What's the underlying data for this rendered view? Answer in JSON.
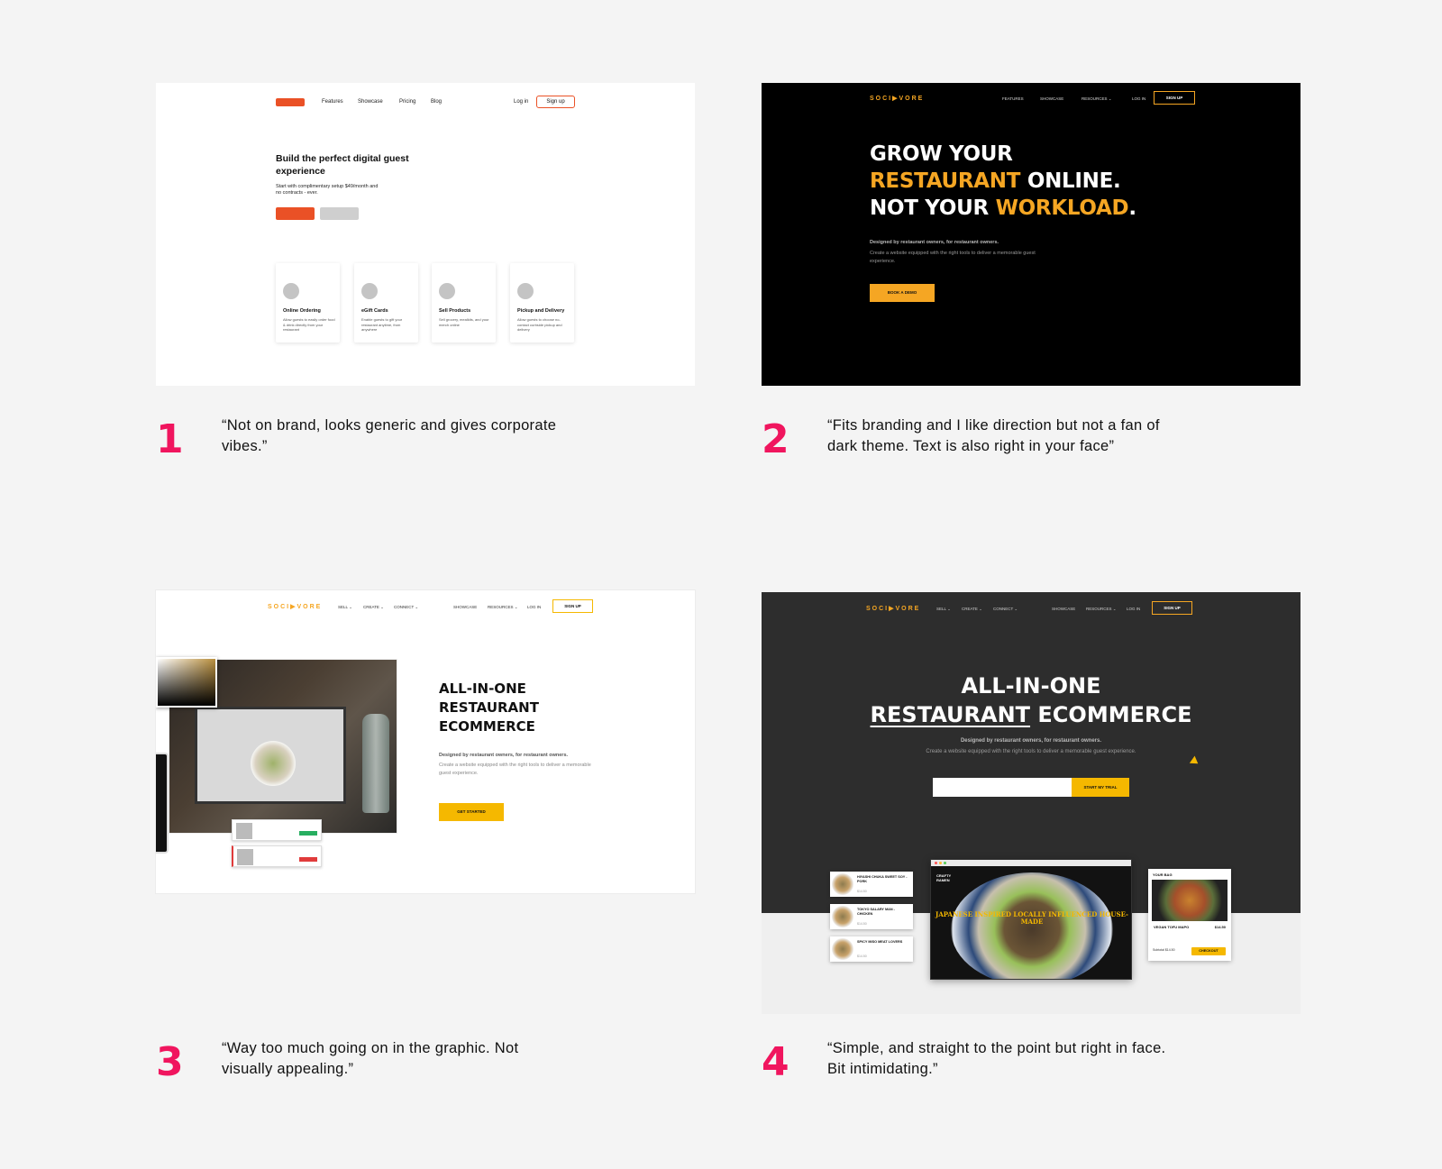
{
  "panel1": {
    "nav": [
      "Features",
      "Showcase",
      "Pricing",
      "Blog"
    ],
    "login": "Log in",
    "signup": "Sign up",
    "headline": "Build the perfect digital guest experience",
    "sub": "Start with complimentary setup $49/month and no contracts - ever.",
    "cards": [
      {
        "title": "Online Ordering",
        "desc": "Allow guests to easily order food & drink directly from your restaurant"
      },
      {
        "title": "eGift Cards",
        "desc": "Enable guests to gift your restaurant anytime, from anywhere"
      },
      {
        "title": "Sell Products",
        "desc": "Sell grocery, mealkits, and your merch online"
      },
      {
        "title": "Pickup and Delivery",
        "desc": "Allow guests to choose no-contact curbside pickup and delivery"
      }
    ],
    "accent": "#ea5126"
  },
  "panel2": {
    "logo": "SOCI▶VORE",
    "nav": [
      "FEATURES",
      "SHOWCASE",
      "RESOURCES ⌄",
      "LOG IN"
    ],
    "signup": "SIGN UP",
    "h_line1": "GROW YOUR",
    "h_line2_y": "RESTAURANT",
    "h_line2_w": " ONLINE.",
    "h_line3_w": "NOT YOUR ",
    "h_line3_y": "WORKLOAD",
    "h_line3_end": ".",
    "sub1": "Designed by restaurant owners, for restaurant owners.",
    "sub2": "Create a website equipped with the right tools to deliver a memorable guest experience.",
    "cta": "BOOK A DEMO",
    "accent": "#f5a623"
  },
  "panel3": {
    "logo": "SOCI▶VORE",
    "nav_left": [
      "SELL ⌄",
      "CREATE ⌄",
      "CONNECT ⌄"
    ],
    "nav_right": [
      "SHOWCASE",
      "RESOURCES ⌄",
      "LOG IN"
    ],
    "signup": "SIGN UP",
    "headline": "ALL-IN-ONE RESTAURANT ECOMMERCE",
    "sub1": "Designed by restaurant owners, for restaurant owners.",
    "sub2": "Create a website equipped with the right tools to deliver a memorable guest experience.",
    "cta": "GET STARTED"
  },
  "panel4": {
    "logo": "SOCI▶VORE",
    "nav_left": [
      "SELL ⌄",
      "CREATE ⌄",
      "CONNECT ⌄"
    ],
    "nav_right": [
      "SHOWCASE",
      "RESOURCES ⌄",
      "LOG IN"
    ],
    "signup": "SIGN UP",
    "h_line1": "ALL-IN-ONE",
    "h_line2_u": "RESTAURANT",
    "h_line2_rest": " ECOMMERCE",
    "sub1": "Designed by restaurant owners, for restaurant owners.",
    "sub2": "Create a website equipped with the right tools to deliver a memorable guest experience.",
    "cta": "START MY TRIAL",
    "menu_items": [
      {
        "name": "HIYASHI CHUKA SWEET SOY - PORK",
        "price": "$14.50"
      },
      {
        "name": "TOKYO SALARY MAN - CHICKEN",
        "price": "$14.50"
      },
      {
        "name": "SPICY MISO MEAT LOVERS",
        "price": "$14.50"
      }
    ],
    "site_brand": "CRAFTY RAMEN",
    "site_tagline": "JAPANESE INSPIRED LOCALLY INFLUENCED HOUSE-MADE",
    "bag_title": "YOUR BAG",
    "bag_item": "VEGAN TOFU MAPO",
    "bag_price": "$14.50",
    "bag_subtotal": "Subtotal $14.50",
    "bag_checkout": "CHECKOUT"
  },
  "feedback": [
    {
      "number": "1",
      "quote": "“Not on brand, looks generic and gives corporate vibes.”"
    },
    {
      "number": "2",
      "quote": "“Fits branding and I like direction but not a fan of dark theme. Text is also right in your face”"
    },
    {
      "number": "3",
      "quote": "“Way too much going on in the graphic. Not visually appealing.”"
    },
    {
      "number": "4",
      "quote": "“Simple, and straight to the point but right in face. Bit intimidating.”"
    }
  ],
  "colors": {
    "number_pink": "#f0155e",
    "yellow": "#f5b800"
  }
}
